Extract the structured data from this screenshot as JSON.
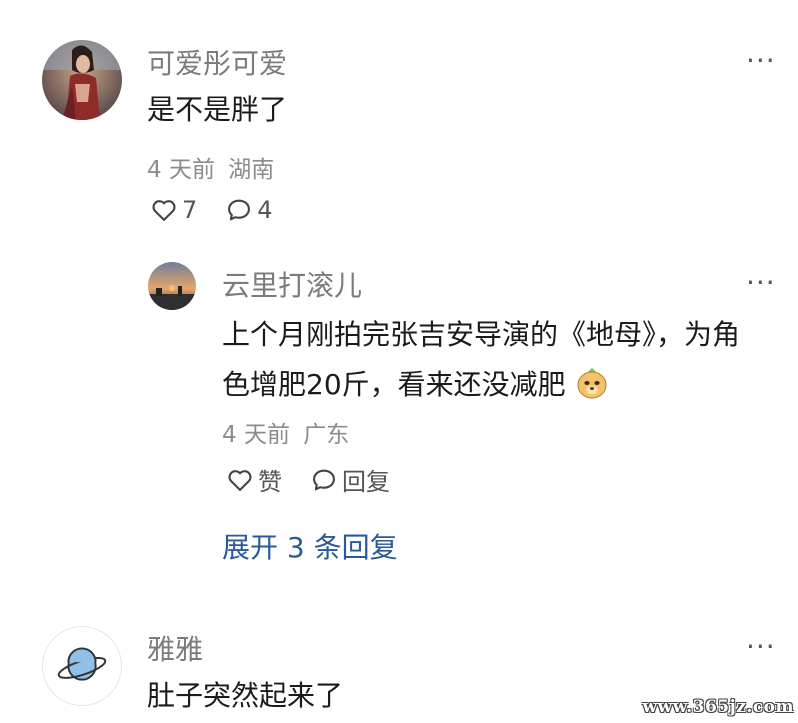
{
  "comments": [
    {
      "username": "可爱彤可爱",
      "text": "是不是胖了",
      "time": "4 天前",
      "location": "湖南",
      "likes": "7",
      "replies_count": "4",
      "more_icon": "more-dots-icon",
      "avatar_icon": "avatar-character-icon"
    },
    {
      "username": "雅雅",
      "text": "肚子突然起来了",
      "more_icon": "more-dots-icon",
      "avatar_icon": "planet-icon"
    }
  ],
  "reply": {
    "username": "云里打滚儿",
    "text_line1": "上个月刚拍完张吉安导演的《地母》，为角",
    "text_line2": "色增肥20斤，看来还没减肥",
    "emoji_icon": "doge-face-emoji-icon",
    "time": "4 天前",
    "location": "广东",
    "like_label": "赞",
    "reply_label": "回复",
    "avatar_icon": "sunset-landscape-avatar-icon"
  },
  "expand_replies": "展开 3 条回复",
  "watermark": "www.365jz.com",
  "colors": {
    "link_blue": "#2a5a99",
    "meta_gray": "#8c8c8c",
    "username_gray": "#7b7b7b"
  }
}
